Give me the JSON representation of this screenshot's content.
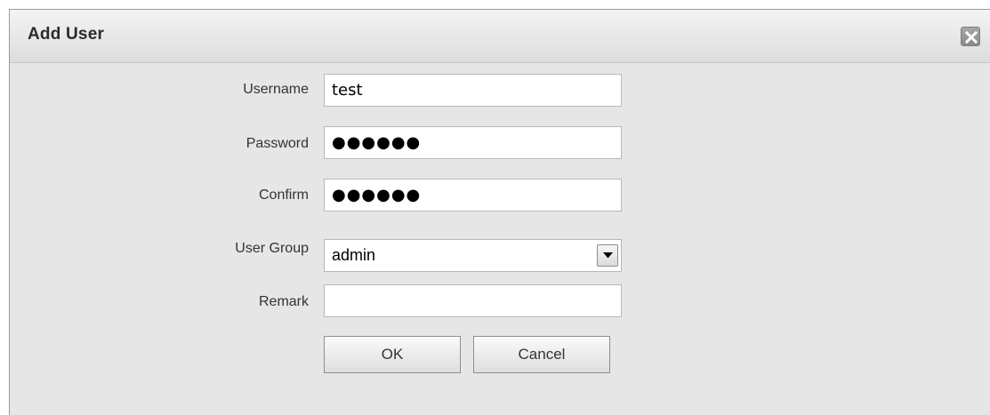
{
  "dialog": {
    "title": "Add User",
    "close_icon": "close-icon"
  },
  "form": {
    "username_label": "Username",
    "username_value": "test",
    "password_label": "Password",
    "password_value": "●●●●●●",
    "confirm_label": "Confirm",
    "confirm_value": "●●●●●●",
    "user_group_label": "User Group",
    "user_group_value": "admin",
    "user_group_arrow_icon": "chevron-down-icon",
    "remark_label": "Remark",
    "remark_value": ""
  },
  "buttons": {
    "ok_label": "OK",
    "cancel_label": "Cancel"
  },
  "colors": {
    "dialog_background": "#e6e6e6",
    "titlebar_background": "#e9e9e9",
    "field_background": "#ffffff",
    "close_button": "#999999"
  }
}
